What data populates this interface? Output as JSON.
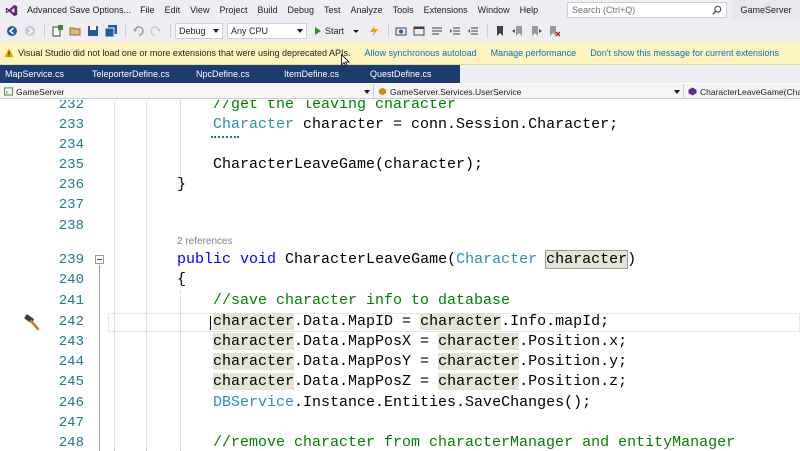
{
  "window": {
    "title": "Advanced Save Options...",
    "solution_name": "GameServer",
    "menus": [
      "File",
      "Edit",
      "View",
      "Project",
      "Build",
      "Debug",
      "Test",
      "Analyze",
      "Tools",
      "Extensions",
      "Window",
      "Help"
    ],
    "search_placeholder": "Search (Ctrl+Q)"
  },
  "toolbar": {
    "configuration": "Debug",
    "platform": "Any CPU",
    "start_label": "Start"
  },
  "infobar": {
    "message": "Visual Studio did not load one or more extensions that were using deprecated APIs.",
    "links": [
      "Allow synchronous autoload",
      "Manage performance",
      "Don't show this message for current extensions"
    ]
  },
  "tabs": [
    "MapService.cs",
    "TeleporterDefine.cs",
    "NpcDefine.cs",
    "ItemDefine.cs",
    "QuestDefine.cs"
  ],
  "navbar": {
    "project": "GameServer",
    "type": "GameServer.Services.UserService",
    "member": "CharacterLeaveGame(Character character)"
  },
  "editor": {
    "code_lens": "2 references",
    "lines": [
      {
        "num": "232",
        "text": "    //get the leaving character"
      },
      {
        "num": "233",
        "text": "    Character character = conn.Session.Character;"
      },
      {
        "num": "234",
        "text": ""
      },
      {
        "num": "235",
        "text": "    CharacterLeaveGame(character);"
      },
      {
        "num": "236",
        "text": "}"
      },
      {
        "num": "237",
        "text": ""
      },
      {
        "num": "238",
        "text": ""
      },
      {
        "num": "239",
        "text": "public void CharacterLeaveGame(Character character)"
      },
      {
        "num": "240",
        "text": "{"
      },
      {
        "num": "241",
        "text": "    //save character info to database"
      },
      {
        "num": "242",
        "text": "    character.Data.MapID = character.Info.mapId;"
      },
      {
        "num": "243",
        "text": "    character.Data.MapPosX = character.Position.x;"
      },
      {
        "num": "244",
        "text": "    character.Data.MapPosY = character.Position.y;"
      },
      {
        "num": "245",
        "text": "    character.Data.MapPosZ = character.Position.z;"
      },
      {
        "num": "246",
        "text": "    DBService.Instance.Entities.SaveChanges();"
      },
      {
        "num": "247",
        "text": ""
      },
      {
        "num": "248",
        "text": "    //remove character from characterManager and entityManager"
      }
    ]
  },
  "colors": {
    "keyword": "#0000ff",
    "type": "#2b91af",
    "comment": "#008000",
    "line_number": "#237893",
    "tab_strip": "#1c3b6e",
    "infobar": "#fdf4bf",
    "highlight": "#e4e4d6"
  }
}
